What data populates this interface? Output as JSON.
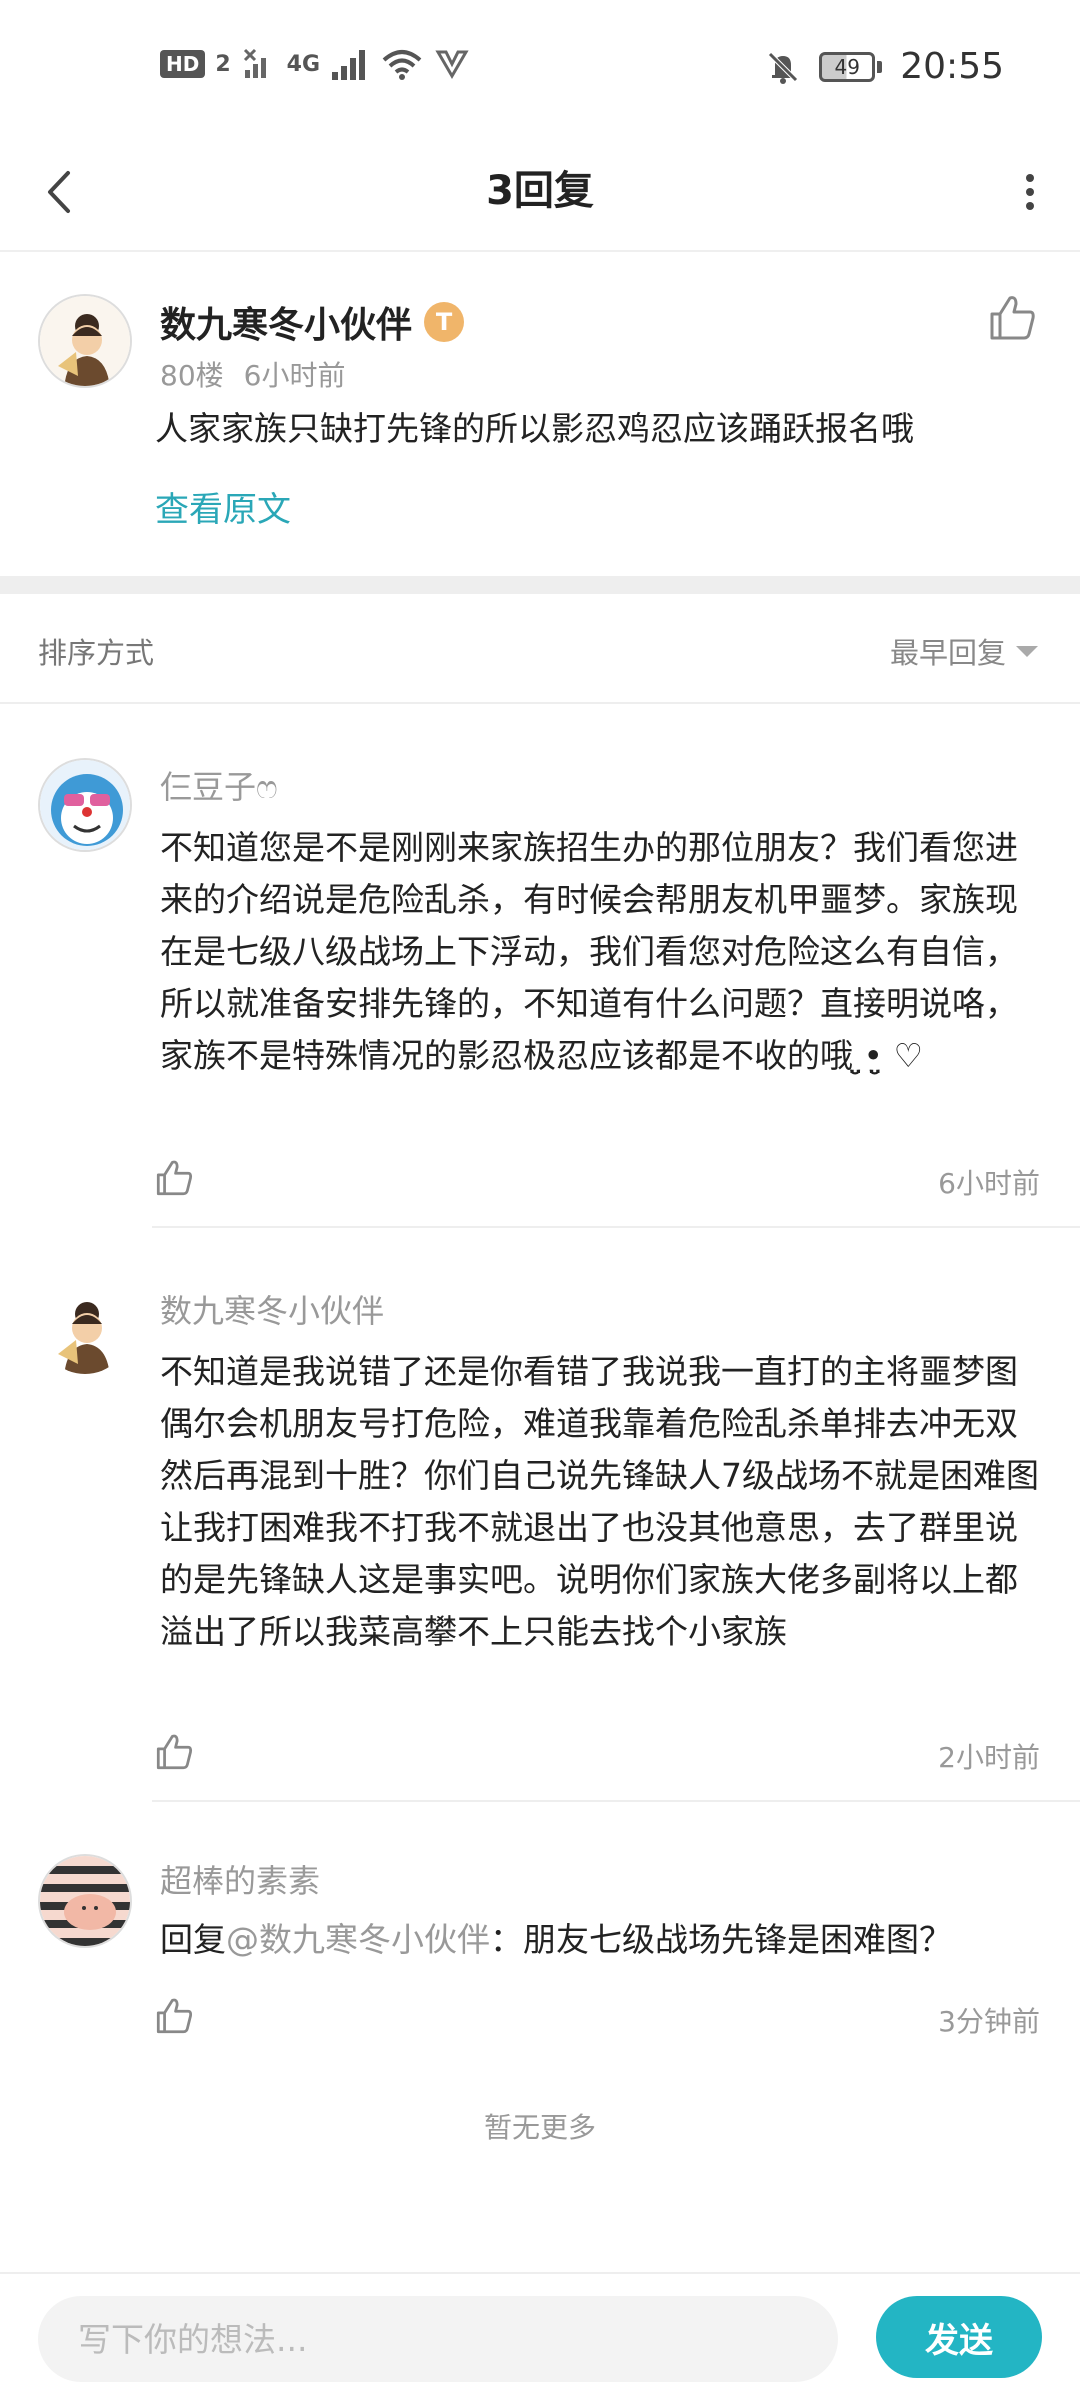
{
  "status_bar": {
    "hd_badge": "HD",
    "sim": "2",
    "network": "4G",
    "battery": "49",
    "time": "20:55"
  },
  "nav": {
    "title": "3回复"
  },
  "post": {
    "author": "数九寒冬小伙伴",
    "level_badge": "T",
    "floor": "80楼",
    "time": "6小时前",
    "content": "人家家族只缺打先锋的所以影忍鸡忍应该踊跃报名哦",
    "view_original": "查看原文"
  },
  "sort": {
    "label": "排序方式",
    "value": "最早回复"
  },
  "replies": [
    {
      "author": "仨豆子ෆ",
      "content": "不知道您是不是刚刚来家族招生办的那位朋友？我们看您进来的介绍说是危险乱杀，有时候会帮朋友机甲噩梦。家族现在是七级八级战场上下浮动，我们看您对危险这么有自信，所以就准备安排先锋的，不知道有什么问题？直接明说咯，家族不是特殊情况的影忍极忍应该都是不收的哦 ̤̮•̤̮ ♡",
      "time": "6小时前"
    },
    {
      "author": "数九寒冬小伙伴",
      "content": "不知道是我说错了还是你看错了我说我一直打的主将噩梦图偶尔会机朋友号打危险，难道我靠着危险乱杀单排去冲无双然后再混到十胜？你们自己说先锋缺人7级战场不就是困难图让我打困难我不打我不就退出了也没其他意思，去了群里说的是先锋缺人这是事实吧。说明你们家族大佬多副将以上都溢出了所以我菜高攀不上只能去找个小家族",
      "time": "2小时前"
    },
    {
      "author": "超棒的素素",
      "reply_prefix": "回复",
      "mention": "@数九寒冬小伙伴",
      "content": "：朋友七级战场先锋是困难图？",
      "time": "3分钟前"
    }
  ],
  "no_more": "暂无更多",
  "composer": {
    "placeholder": "写下你的想法...",
    "send_label": "发送"
  },
  "colors": {
    "accent": "#23b5c4",
    "link": "#2aa7b7",
    "muted": "#999999"
  }
}
